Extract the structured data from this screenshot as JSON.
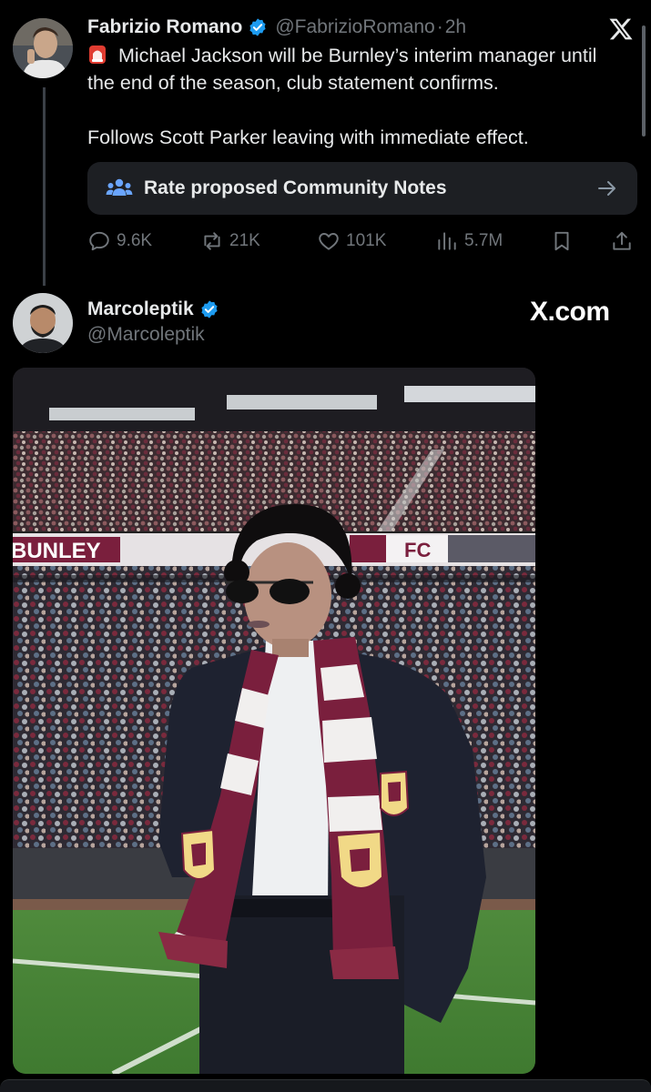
{
  "tweet": {
    "author_name": "Fabrizio Romano",
    "author_handle": "@FabrizioRomano",
    "separator": "·",
    "time": "2h",
    "line1": "Michael Jackson will be Burnley’s interim manager until the end of the season, club statement confirms.",
    "line2": "Follows Scott Parker leaving with immediate effect.",
    "community_notes_label": "Rate proposed Community Notes",
    "actions": {
      "replies": "9.6K",
      "reposts": "21K",
      "likes": "101K",
      "views": "5.7M"
    }
  },
  "embedded": {
    "author_name": "Marcoleptik",
    "author_handle": "@Marcoleptik",
    "watermark": "X.com",
    "signage": {
      "left": "BUNLEY",
      "right": "FC"
    }
  },
  "icons": {
    "brand": "x-logo-icon",
    "verified": "verified-badge-icon",
    "alert": "siren-emoji-icon",
    "notes": "people-icon",
    "arrow": "arrow-right-icon",
    "reply": "reply-icon",
    "repost": "repost-icon",
    "like": "heart-icon",
    "views": "views-icon",
    "bookmark": "bookmark-icon",
    "share": "share-icon"
  },
  "colors": {
    "background": "#000000",
    "text": "#e7e9ea",
    "muted": "#71767b",
    "verified": "#1d9bf0",
    "notes_box": "#1d1f23",
    "claret": "#7a1f3d",
    "sky_blue": "#9fc3e7"
  }
}
